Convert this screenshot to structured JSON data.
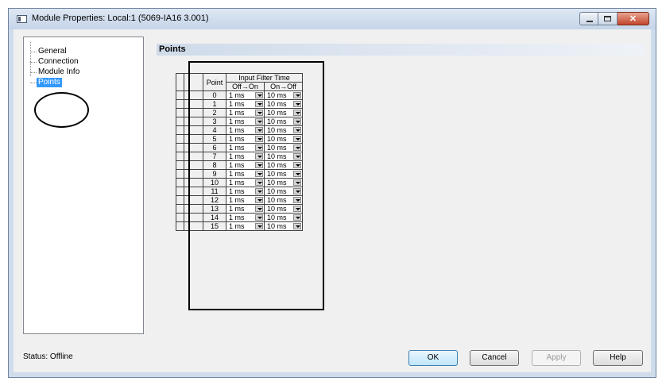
{
  "window": {
    "title": "Module Properties: Local:1 (5069-IA16 3.001)"
  },
  "tree": {
    "items": [
      {
        "label": "General",
        "selected": false
      },
      {
        "label": "Connection",
        "selected": false
      },
      {
        "label": "Module Info",
        "selected": false
      },
      {
        "label": "Points",
        "selected": true
      }
    ]
  },
  "section": {
    "title": "Points"
  },
  "points_table": {
    "headers": {
      "point": "Point",
      "filter_group": "Input Filter Time",
      "off_on": "Off→On",
      "on_off": "On→Off"
    },
    "rows": [
      {
        "point": "0",
        "off_on": "1 ms",
        "on_off": "10 ms"
      },
      {
        "point": "1",
        "off_on": "1 ms",
        "on_off": "10 ms"
      },
      {
        "point": "2",
        "off_on": "1 ms",
        "on_off": "10 ms"
      },
      {
        "point": "3",
        "off_on": "1 ms",
        "on_off": "10 ms"
      },
      {
        "point": "4",
        "off_on": "1 ms",
        "on_off": "10 ms"
      },
      {
        "point": "5",
        "off_on": "1 ms",
        "on_off": "10 ms"
      },
      {
        "point": "6",
        "off_on": "1 ms",
        "on_off": "10 ms"
      },
      {
        "point": "7",
        "off_on": "1 ms",
        "on_off": "10 ms"
      },
      {
        "point": "8",
        "off_on": "1 ms",
        "on_off": "10 ms"
      },
      {
        "point": "9",
        "off_on": "1 ms",
        "on_off": "10 ms"
      },
      {
        "point": "10",
        "off_on": "1 ms",
        "on_off": "10 ms"
      },
      {
        "point": "11",
        "off_on": "1 ms",
        "on_off": "10 ms"
      },
      {
        "point": "12",
        "off_on": "1 ms",
        "on_off": "10 ms"
      },
      {
        "point": "13",
        "off_on": "1 ms",
        "on_off": "10 ms"
      },
      {
        "point": "14",
        "off_on": "1 ms",
        "on_off": "10 ms"
      },
      {
        "point": "15",
        "off_on": "1 ms",
        "on_off": "10 ms"
      }
    ]
  },
  "status": {
    "label": "Status:",
    "value": "Offline"
  },
  "buttons": {
    "ok": "OK",
    "cancel": "Cancel",
    "apply": "Apply",
    "help": "Help"
  }
}
